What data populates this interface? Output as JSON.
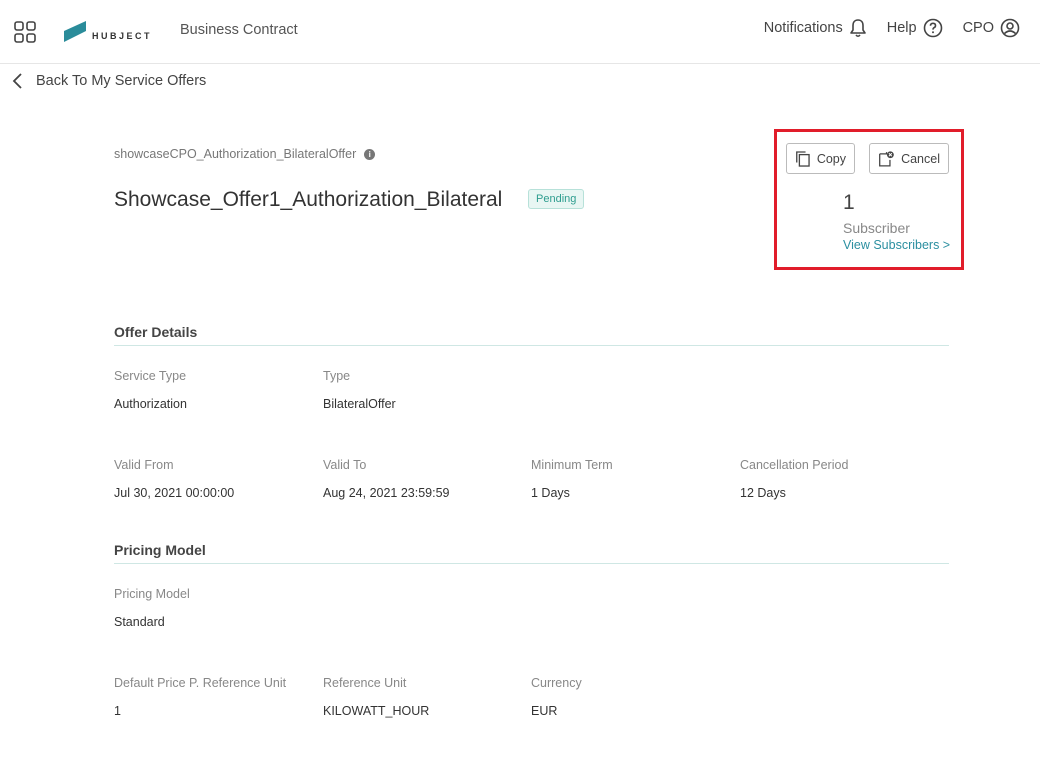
{
  "header": {
    "logo_text": "HUBJECT",
    "app_title": "Business Contract",
    "notifications_label": "Notifications",
    "help_label": "Help",
    "user_label": "CPO"
  },
  "back": {
    "label": "Back To My Service Offers"
  },
  "offer": {
    "identifier": "showcaseCPO_Authorization_BilateralOffer",
    "title": "Showcase_Offer1_Authorization_Bilateral",
    "status": "Pending"
  },
  "actions": {
    "copy_label": "Copy",
    "cancel_label": "Cancel",
    "subscriber_count": "1",
    "subscriber_label": "Subscriber",
    "view_subscribers_label": "View Subscribers >"
  },
  "offer_details": {
    "title": "Offer Details",
    "service_type": {
      "label": "Service Type",
      "value": "Authorization"
    },
    "type": {
      "label": "Type",
      "value": "BilateralOffer"
    },
    "valid_from": {
      "label": "Valid From",
      "value": "Jul 30, 2021 00:00:00"
    },
    "valid_to": {
      "label": "Valid To",
      "value": "Aug 24, 2021 23:59:59"
    },
    "minimum_term": {
      "label": "Minimum Term",
      "value": "1 Days"
    },
    "cancellation_period": {
      "label": "Cancellation Period",
      "value": "12 Days"
    }
  },
  "pricing_model": {
    "title": "Pricing Model",
    "model": {
      "label": "Pricing Model",
      "value": "Standard"
    },
    "default_price": {
      "label": "Default Price P. Reference Unit",
      "value": "1"
    },
    "reference_unit": {
      "label": "Reference Unit",
      "value": "KILOWATT_HOUR"
    },
    "currency": {
      "label": "Currency",
      "value": "EUR"
    }
  },
  "colors": {
    "accent": "#2b8fa0",
    "logo": "#2a8c9a",
    "status_pending_bg": "#e8f6f3",
    "status_pending_text": "#2e9d8f",
    "highlight": "#e11d2a"
  },
  "icons": [
    "apps-grid-icon",
    "hubject-logo",
    "bell-icon",
    "help-circle-icon",
    "user-circle-icon",
    "chevron-left-icon",
    "info-icon",
    "copy-icon",
    "cancel-document-icon"
  ]
}
